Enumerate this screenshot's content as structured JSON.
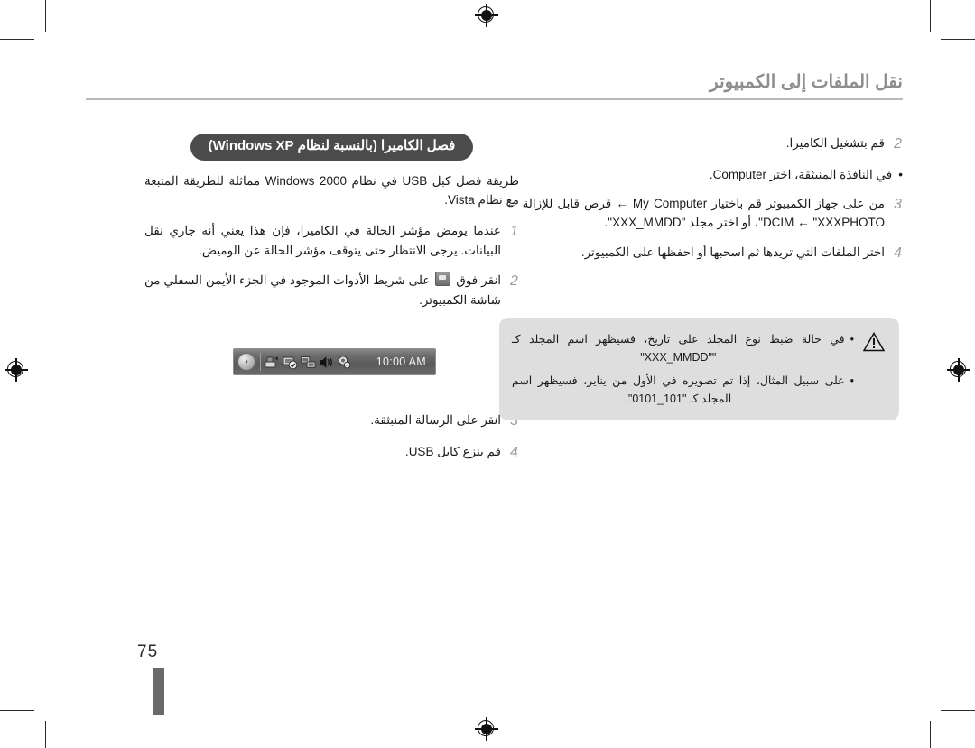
{
  "page": {
    "header_title": "نقل الملفات إلى الكمبيوتر",
    "folio": "75"
  },
  "left_column": {
    "badge": "فصل الكاميرا (بالنسبة لنظام Windows XP)",
    "intro": "طريقة فصل كبل USB في نظام Windows 2000 مماثلة للطريقة المتبعة مع نظام Vista.",
    "steps": [
      {
        "num": "1",
        "text": "عندما يومض مؤشر الحالة في الكاميرا، فإن هذا يعني أنه جاري نقل البيانات. يرجى الانتظار حتى يتوقف مؤشر الحالة عن الوميض."
      },
      {
        "num": "2",
        "text_before": "انقر فوق",
        "icon": "safely-remove-hardware-icon",
        "text_after": "على شريط الأدوات الموجود في الجزء الأيمن السفلي من شاشة الكمبيوتر."
      },
      {
        "num": "3",
        "text": "انقر على الرسالة المنبثقة."
      },
      {
        "num": "4",
        "text": "قم بنزع كابل USB."
      }
    ],
    "tray_screenshot": {
      "chevron": "›",
      "icons": [
        "safely-remove-hardware-icon",
        "security-center-shield-icon",
        "network-connection-icon",
        "volume-speaker-icon",
        "wireless-status-icon"
      ],
      "clock": "10:00 AM"
    }
  },
  "right_column": {
    "steps": [
      {
        "num": "2",
        "text": "قم بتشغيل الكاميرا."
      },
      {
        "num": "3",
        "text": "من على جهاز الكمبيوتر قم باختيار My Computer ← قرص قابل للإزالة ← DCIM ← \"XXXPHOTO\"، أو اختر مجلد \"XXX_MMDD\"."
      },
      {
        "num": "4",
        "text": "اختر الملفات التي تريدها ثم اسحبها أو احفظها على الكمبيوتر."
      }
    ],
    "bullets": [
      {
        "dot": "•",
        "text": "في النافذة المنبثقة، اختر Computer."
      }
    ]
  },
  "note_box": {
    "icon": "caution-triangle-icon",
    "bullets": [
      {
        "dot": "•",
        "text": "في حالة ضبط نوع المجلد على تاريخ، فسيظهر اسم المجلد كـ \"\"XXX_MMDD\""
      },
      {
        "dot": "•",
        "text": "على سبيل المثال، إذا تم تصويره في الأول من يناير، فسيظهر اسم المجلد كـ \"101_0101\"."
      }
    ]
  },
  "colors": {
    "header_gray": "#8e8e8e",
    "badge_bg": "#4c4c4c",
    "note_bg": "#dedede",
    "step_number": "#9b9b9b"
  }
}
